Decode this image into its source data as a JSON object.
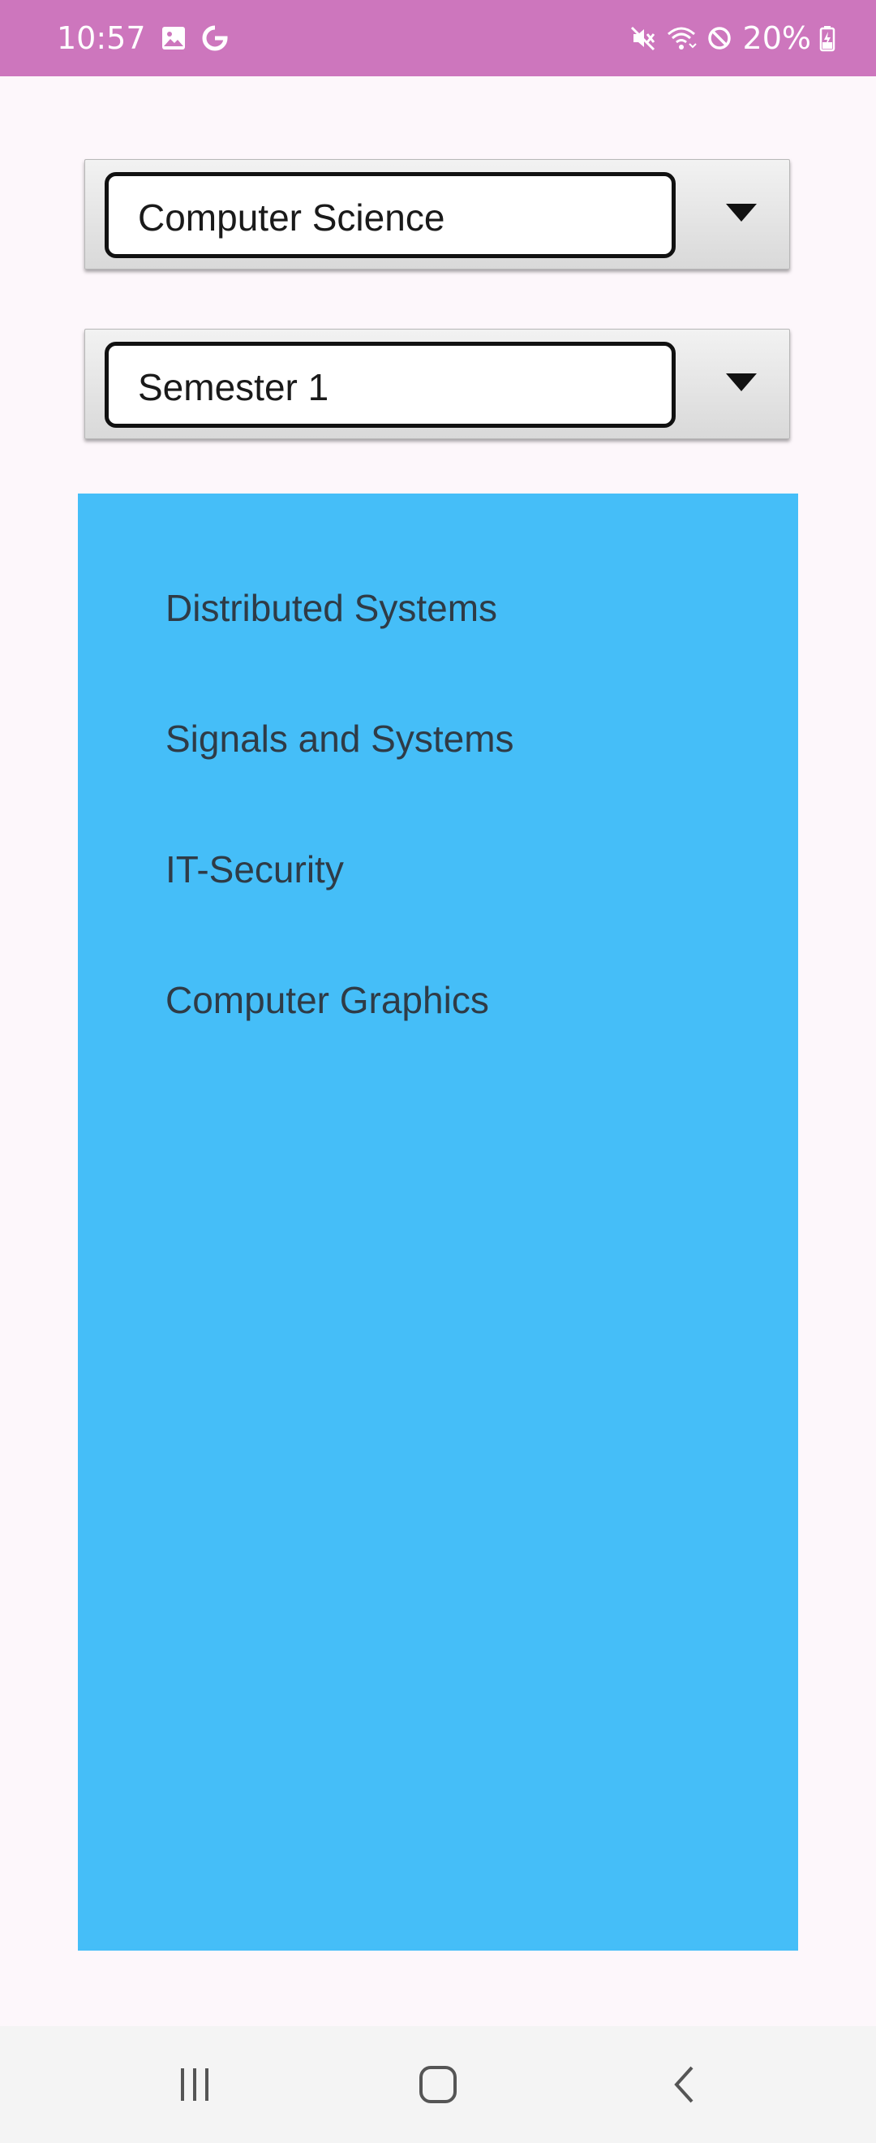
{
  "status_bar": {
    "time": "10:57",
    "battery": "20%",
    "icons": [
      "gallery-icon",
      "google-icon",
      "mute-icon",
      "wifi-icon",
      "do-not-disturb-icon",
      "battery-charging-icon"
    ],
    "background": "#cd76bd"
  },
  "spinners": {
    "department": {
      "selected": "Computer Science"
    },
    "semester": {
      "selected": "Semester 1"
    }
  },
  "courses": {
    "background": "#45bef8",
    "items": [
      "Distributed Systems",
      "Signals and Systems",
      "IT-Security",
      "Computer Graphics"
    ]
  },
  "nav_bar": {
    "icons": [
      "recent-apps-icon",
      "home-icon",
      "back-icon"
    ]
  }
}
